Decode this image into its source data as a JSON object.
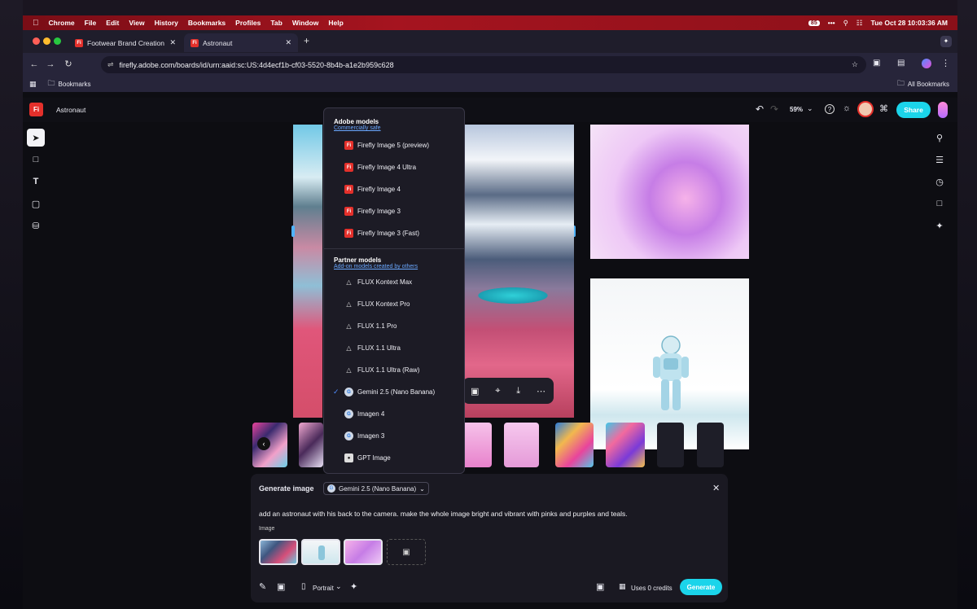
{
  "menubar": {
    "app": "Chrome",
    "items": [
      "File",
      "Edit",
      "View",
      "History",
      "Bookmarks",
      "Profiles",
      "Tab",
      "Window",
      "Help"
    ],
    "battery": "85",
    "datetime": "Tue Oct 28  10:03:36 AM"
  },
  "tabs": [
    {
      "title": "Footwear Brand Creation"
    },
    {
      "title": "Astronaut"
    }
  ],
  "address": {
    "url": "firefly.adobe.com/boards/id/urn:aaid:sc:US:4d4ecf1b-cf03-5520-8b4b-a1e2b959c628"
  },
  "bookmarks": {
    "folder": "Bookmarks",
    "all": "All Bookmarks"
  },
  "app": {
    "board_title": "Astronaut",
    "zoom": "59%",
    "share": "Share"
  },
  "dropdown": {
    "adobe_header": "Adobe models",
    "adobe_sub": "Commercially safe",
    "adobe_models": [
      "Firefly Image 5 (preview)",
      "Firefly Image 4 Ultra",
      "Firefly Image 4",
      "Firefly Image 3",
      "Firefly Image 3 (Fast)"
    ],
    "partner_header": "Partner models",
    "partner_sub": "Add-on models created by others",
    "partner_models": [
      "FLUX Kontext Max",
      "FLUX Kontext Pro",
      "FLUX 1.1 Pro",
      "FLUX 1.1 Ultra",
      "FLUX 1.1 Ultra (Raw)",
      "Gemini 2.5 (Nano Banana)",
      "Imagen 4",
      "Imagen 3",
      "GPT Image"
    ],
    "selected": "Gemini 2.5 (Nano Banana)"
  },
  "generate": {
    "title": "Generate image",
    "model": "Gemini 2.5 (Nano Banana)",
    "prompt": "add an astronaut with his back to the camera. make the whole image bright and vibrant with pinks and purples and teals.",
    "image_label": "Image",
    "aspect": "Portrait",
    "credits": "Uses 0 credits",
    "button": "Generate"
  },
  "colors": {
    "accent": "#1bd4ea",
    "firefly_red": "#e4302b",
    "menubar_red": "#a5141f",
    "link_blue": "#6aa8ff"
  }
}
